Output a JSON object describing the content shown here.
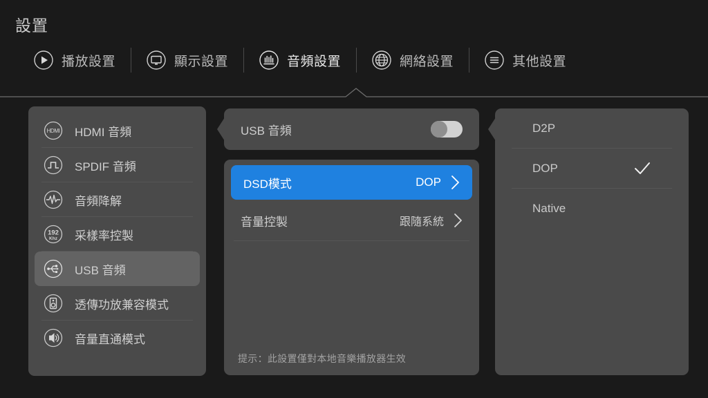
{
  "header": {
    "title": "設置",
    "tabs": [
      {
        "label": "播放設置",
        "icon": "play-circle-icon",
        "active": false
      },
      {
        "label": "顯示設置",
        "icon": "monitor-icon",
        "active": false
      },
      {
        "label": "音頻設置",
        "icon": "audio-wave-circle-icon",
        "active": true
      },
      {
        "label": "網絡設置",
        "icon": "globe-icon",
        "active": false
      },
      {
        "label": "其他設置",
        "icon": "menu-list-circle-icon",
        "active": false
      }
    ]
  },
  "sidebar": {
    "items": [
      {
        "label": "HDMI 音頻",
        "icon": "hdmi-icon",
        "selected": false
      },
      {
        "label": "SPDIF 音頻",
        "icon": "square-wave-icon",
        "selected": false
      },
      {
        "label": "音頻降解",
        "icon": "waveform-icon",
        "selected": false
      },
      {
        "label": "采樣率控製",
        "icon": "192khz-icon",
        "selected": false
      },
      {
        "label": "USB 音頻",
        "icon": "usb-icon",
        "selected": true
      },
      {
        "label": "透傳功放兼容模式",
        "icon": "speaker-icon",
        "selected": false
      },
      {
        "label": "音量直通模式",
        "icon": "sound-waves-icon",
        "selected": false
      }
    ]
  },
  "middle": {
    "toggle_row": {
      "label": "USB 音頻",
      "toggle_state": "off"
    },
    "rows": [
      {
        "label": "DSD模式",
        "value": "DOP",
        "highlighted": true
      },
      {
        "label": "音量控製",
        "value": "跟隨系統",
        "highlighted": false
      }
    ],
    "hint": "提示：此設置僅對本地音樂播放器生效"
  },
  "right": {
    "options": [
      {
        "label": "D2P",
        "checked": false
      },
      {
        "label": "DOP",
        "checked": true
      },
      {
        "label": "Native",
        "checked": false
      }
    ]
  },
  "colors": {
    "background": "#1a1a1a",
    "panel": "#4a4a4a",
    "selected_item": "#636363",
    "accent_blue": "#1f81e0",
    "text_primary": "#cfcfcf",
    "text_muted": "#a2a2a2",
    "toggle_track": "#d2d2d2",
    "toggle_knob": "#8f8f8f"
  }
}
